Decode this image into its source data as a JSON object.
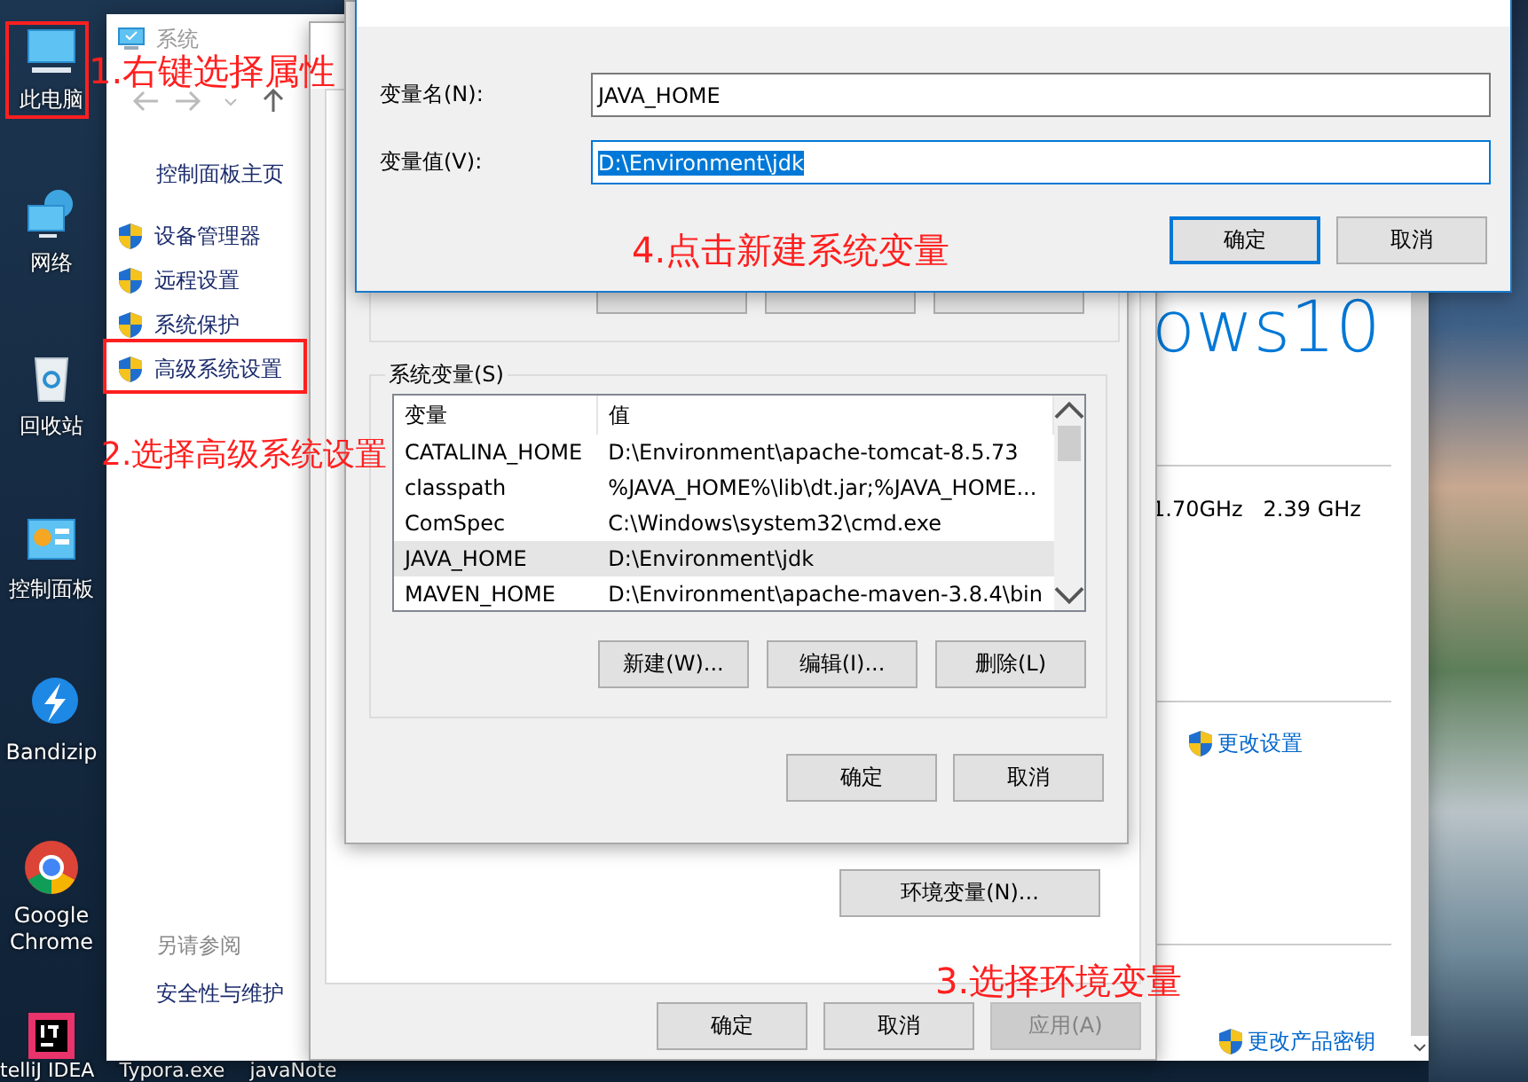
{
  "desktop_icons": [
    {
      "kind": "computer",
      "label": "此电脑"
    },
    {
      "kind": "network",
      "label": "网络"
    },
    {
      "kind": "recycle",
      "label": "回收站"
    },
    {
      "kind": "control-panel",
      "label": "控制面板"
    },
    {
      "kind": "bandizip",
      "label": "Bandizip"
    },
    {
      "kind": "chrome",
      "label": "Google Chrome"
    },
    {
      "kind": "intellij"
    }
  ],
  "bottom_labels": [
    "telliJ IDEA",
    "Typora.exe",
    "javaNote"
  ],
  "system_window": {
    "title": "系统",
    "nav_home": "控制面板主页",
    "tasks": [
      "设备管理器",
      "远程设置",
      "系统保护",
      "高级系统设置"
    ],
    "see_also_heading": "另请参阅",
    "see_also": [
      "安全性与维护"
    ],
    "edition_logo": "ows10",
    "processor_speed": "1.70GHz   2.39 GHz",
    "change_settings": "更改设置",
    "change_key": "更改产品密钥"
  },
  "system_properties": {
    "env_button": "环境变量(N)...",
    "buttons": [
      {
        "label": "确定",
        "disabled": false
      },
      {
        "label": "取消",
        "disabled": false
      },
      {
        "label": "应用(A)",
        "disabled": true
      }
    ]
  },
  "env_dialog": {
    "system_group": "系统变量(S)",
    "columns": [
      "变量",
      "值"
    ],
    "rows": [
      {
        "name": "CATALINA_HOME",
        "value": "D:\\Environment\\apache-tomcat-8.5.73",
        "selected": false
      },
      {
        "name": "classpath",
        "value": "%JAVA_HOME%\\lib\\dt.jar;%JAVA_HOME...",
        "selected": false
      },
      {
        "name": "ComSpec",
        "value": "C:\\Windows\\system32\\cmd.exe",
        "selected": false
      },
      {
        "name": "JAVA_HOME",
        "value": "D:\\Environment\\jdk",
        "selected": true
      },
      {
        "name": "MAVEN_HOME",
        "value": "D:\\Environment\\apache-maven-3.8.4\\bin",
        "selected": false
      }
    ],
    "buttons": [
      "新建(W)...",
      "编辑(I)...",
      "删除(L)"
    ],
    "footer": [
      "确定",
      "取消"
    ]
  },
  "edit_dialog": {
    "fields": [
      {
        "label": "变量名(N):",
        "value": "JAVA_HOME",
        "focused": false
      },
      {
        "label": "变量值(V):",
        "value": "D:\\Environment\\jdk",
        "focused": true
      }
    ],
    "buttons": [
      {
        "label": "确定",
        "default": true
      },
      {
        "label": "取消",
        "default": false
      }
    ]
  },
  "annotations": [
    "1.右键选择属性",
    "2.选择高级系统设置",
    "3.选择环境变量",
    "4.点击新建系统变量"
  ]
}
